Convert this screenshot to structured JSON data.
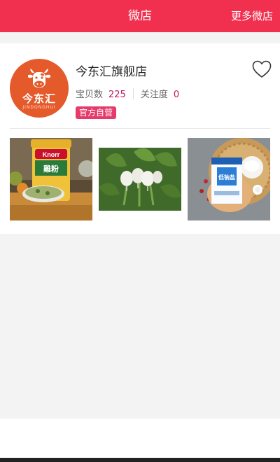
{
  "header": {
    "title": "微店",
    "more_label": "更多微店"
  },
  "shop": {
    "name": "今东汇旗舰店",
    "logo_text": "今东汇",
    "logo_subtext": "JINDONGHUI",
    "stats": {
      "products_label": "宝贝数",
      "products_value": "225",
      "followers_label": "关注度",
      "followers_value": "0"
    },
    "badge": "官方自营",
    "favorite_icon": "heart-outline-icon",
    "products": [
      {
        "icon": "chicken-powder-jar-image",
        "brand": "Knorr",
        "label": "雞粉"
      },
      {
        "icon": "radish-image"
      },
      {
        "icon": "salt-package-image",
        "label": "低钠盐"
      }
    ]
  },
  "colors": {
    "brand_red": "#f0304e",
    "accent_number": "#c2185b",
    "badge": "#e63a6a"
  }
}
